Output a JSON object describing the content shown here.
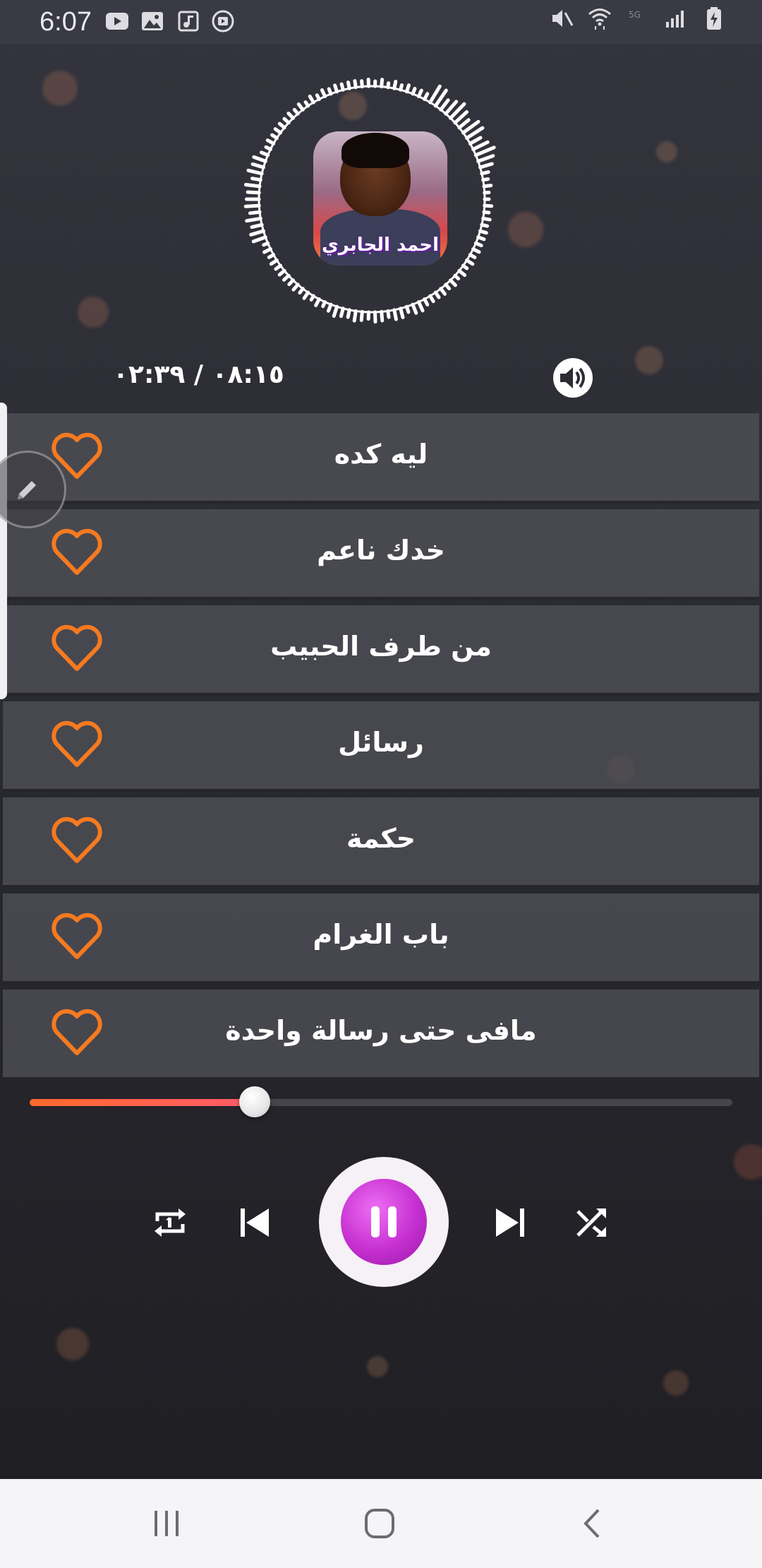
{
  "status_bar": {
    "time": "6:07",
    "left_icons": [
      "youtube-icon",
      "gallery-icon",
      "music-note-icon",
      "cast-icon"
    ],
    "right_icons": [
      "mute-icon",
      "wifi-icon",
      "signal-5g-icon",
      "signal-bars-icon",
      "battery-charging-icon"
    ]
  },
  "player": {
    "album_title": "احمد الجابري",
    "time_readout": "٠٨:١٥ / ٠٢:٣٩",
    "volume_icon": "volume-icon",
    "progress": 0.32
  },
  "tracks": [
    {
      "title": "ليه كده"
    },
    {
      "title": "خدك ناعم"
    },
    {
      "title": "من طرف الحبيب"
    },
    {
      "title": "رسائل"
    },
    {
      "title": "حكمة"
    },
    {
      "title": "باب الغرام"
    },
    {
      "title": "مافى حتى رسالة واحدة"
    }
  ],
  "controls": [
    "repeat-one-icon",
    "previous-icon",
    "pause-icon",
    "next-icon",
    "shuffle-icon"
  ],
  "colors": {
    "accent_orange": "#f47a20",
    "play_purple": "#c52fd0",
    "track_bg": "#4e4e56"
  },
  "nav": [
    "recent-apps-icon",
    "home-icon",
    "back-icon"
  ]
}
